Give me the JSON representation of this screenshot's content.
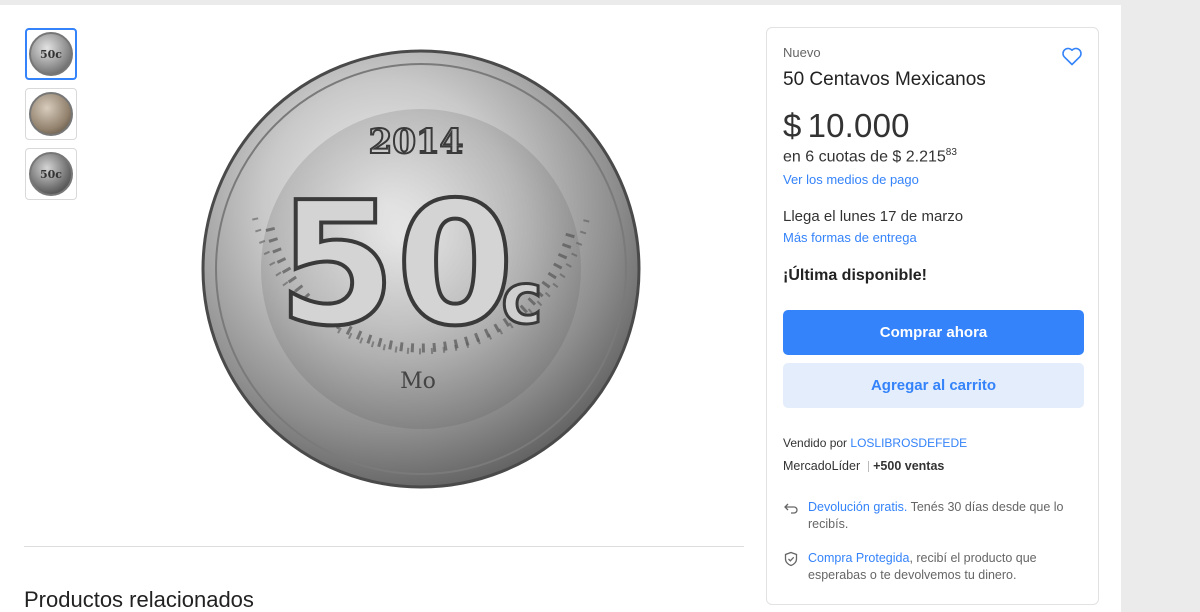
{
  "gallery": {
    "thumbnails": [
      {
        "label": "50c",
        "style": "default",
        "active": true
      },
      {
        "label": "",
        "style": "sepia",
        "active": false
      },
      {
        "label": "50c",
        "style": "dark",
        "active": false
      }
    ],
    "main_image": {
      "year": "2014",
      "denomination": "50",
      "unit": "c",
      "mint_mark": "Mo"
    }
  },
  "product": {
    "condition": "Nuevo",
    "title": "50 Centavos Mexicanos",
    "price_symbol": "$",
    "price": "10.000",
    "installments_text": "en 6 cuotas de $ 2.215",
    "installments_cents": "83",
    "payment_link": "Ver los medios de pago",
    "delivery": "Llega el lunes 17 de marzo",
    "delivery_link": "Más formas de entrega",
    "stock": "¡Última disponible!"
  },
  "actions": {
    "buy_now": "Comprar ahora",
    "add_to_cart": "Agregar al carrito"
  },
  "seller": {
    "prefix": "Vendido por",
    "name": "LOSLIBROSDEFEDE",
    "status": "MercadoLíder",
    "sales": "+500 ventas"
  },
  "benefits": [
    {
      "icon": "return-icon",
      "link": "Devolución gratis.",
      "text": "Tenés 30 días desde que lo recibís."
    },
    {
      "icon": "shield-icon",
      "link": "Compra Protegida",
      "text": ", recibí el producto que esperabas o te devolvemos tu dinero."
    }
  ],
  "related": {
    "title": "Productos relacionados"
  },
  "colors": {
    "accent": "#3483fa",
    "accent_light": "rgba(65,137,230,0.15)",
    "background": "#ebebeb"
  }
}
